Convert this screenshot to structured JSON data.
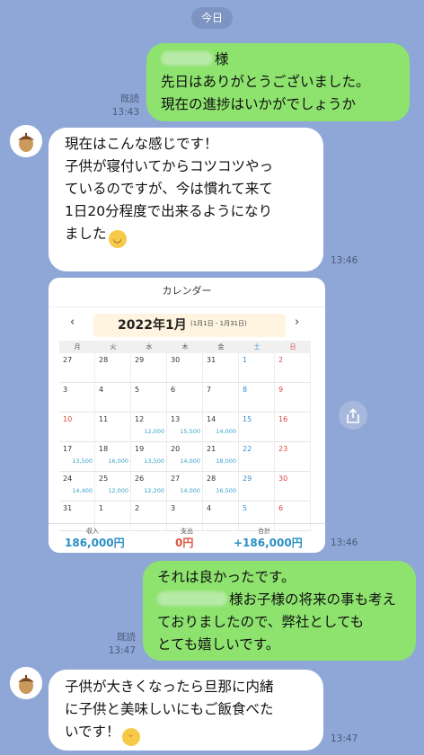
{
  "date_divider": "今日",
  "messages": [
    {
      "line1_suffix": "様",
      "line2": "先日はありがとうございました。",
      "line3": "現在の進捗はいかがでしょうか",
      "read": "既読",
      "time": "13:43"
    },
    {
      "lines": [
        "現在はこんな感じです！",
        "子供が寝付いてからコツコツやっ",
        "ているのですが、今は慣れて来て",
        "1日20分程度で出来るようになり",
        "ました"
      ],
      "time": "13:46"
    },
    {
      "line1": "それは良かったです。",
      "line2_suffix": "様お子様の将来の事も考え",
      "line3": "ておりましたので、弊社としても",
      "line4": "とても嬉しいです。",
      "read": "既読",
      "time": "13:47"
    },
    {
      "lines": [
        "子供が大きくなったら旦那に内緒",
        "に子供と美味しいにもご飯食べた",
        "いです！"
      ],
      "time": "13:47"
    }
  ],
  "calendar_image": {
    "header": "カレンダー",
    "month": "2022年1月",
    "range": "(1月1日 - 1月31日)",
    "prev": "‹",
    "next": "›",
    "weekdays": [
      "月",
      "火",
      "水",
      "木",
      "金",
      "土",
      "日"
    ],
    "weeks": [
      [
        {
          "d": "27",
          "a": ""
        },
        {
          "d": "28",
          "a": ""
        },
        {
          "d": "29",
          "a": ""
        },
        {
          "d": "30",
          "a": ""
        },
        {
          "d": "31",
          "a": ""
        },
        {
          "d": "1",
          "a": ""
        },
        {
          "d": "2",
          "a": ""
        }
      ],
      [
        {
          "d": "3",
          "a": ""
        },
        {
          "d": "4",
          "a": ""
        },
        {
          "d": "5",
          "a": ""
        },
        {
          "d": "6",
          "a": ""
        },
        {
          "d": "7",
          "a": ""
        },
        {
          "d": "8",
          "a": ""
        },
        {
          "d": "9",
          "a": ""
        }
      ],
      [
        {
          "d": "10",
          "a": ""
        },
        {
          "d": "11",
          "a": ""
        },
        {
          "d": "12",
          "a": "12,000"
        },
        {
          "d": "13",
          "a": "15,500"
        },
        {
          "d": "14",
          "a": "14,000"
        },
        {
          "d": "15",
          "a": ""
        },
        {
          "d": "16",
          "a": ""
        }
      ],
      [
        {
          "d": "17",
          "a": "13,500"
        },
        {
          "d": "18",
          "a": "16,000"
        },
        {
          "d": "19",
          "a": "13,500"
        },
        {
          "d": "20",
          "a": "14,000"
        },
        {
          "d": "21",
          "a": "18,000"
        },
        {
          "d": "22",
          "a": ""
        },
        {
          "d": "23",
          "a": ""
        }
      ],
      [
        {
          "d": "24",
          "a": "14,400"
        },
        {
          "d": "25",
          "a": "12,000"
        },
        {
          "d": "26",
          "a": "12,200"
        },
        {
          "d": "27",
          "a": "14,000"
        },
        {
          "d": "28",
          "a": "16,500"
        },
        {
          "d": "29",
          "a": ""
        },
        {
          "d": "30",
          "a": ""
        }
      ],
      [
        {
          "d": "31",
          "a": ""
        },
        {
          "d": "1",
          "a": ""
        },
        {
          "d": "2",
          "a": ""
        },
        {
          "d": "3",
          "a": ""
        },
        {
          "d": "4",
          "a": ""
        },
        {
          "d": "5",
          "a": ""
        },
        {
          "d": "6",
          "a": ""
        }
      ]
    ],
    "income_label": "収入",
    "income": "186,000円",
    "expense_label": "支出",
    "expense": "0円",
    "total_label": "合計",
    "total": "+186,000円"
  },
  "colors": {
    "background": "#8fa7d6",
    "outgoing_bubble": "#8ee36f",
    "incoming_bubble": "#ffffff",
    "amount": "#37a3c9",
    "saturday": "#3a8fd0",
    "sunday": "#d9463f"
  },
  "icons": {
    "avatar": "acorn-avatar-icon",
    "share": "share-icon",
    "emoji_smile": "relieved-face-emoji",
    "emoji_yum": "yum-face-emoji"
  }
}
